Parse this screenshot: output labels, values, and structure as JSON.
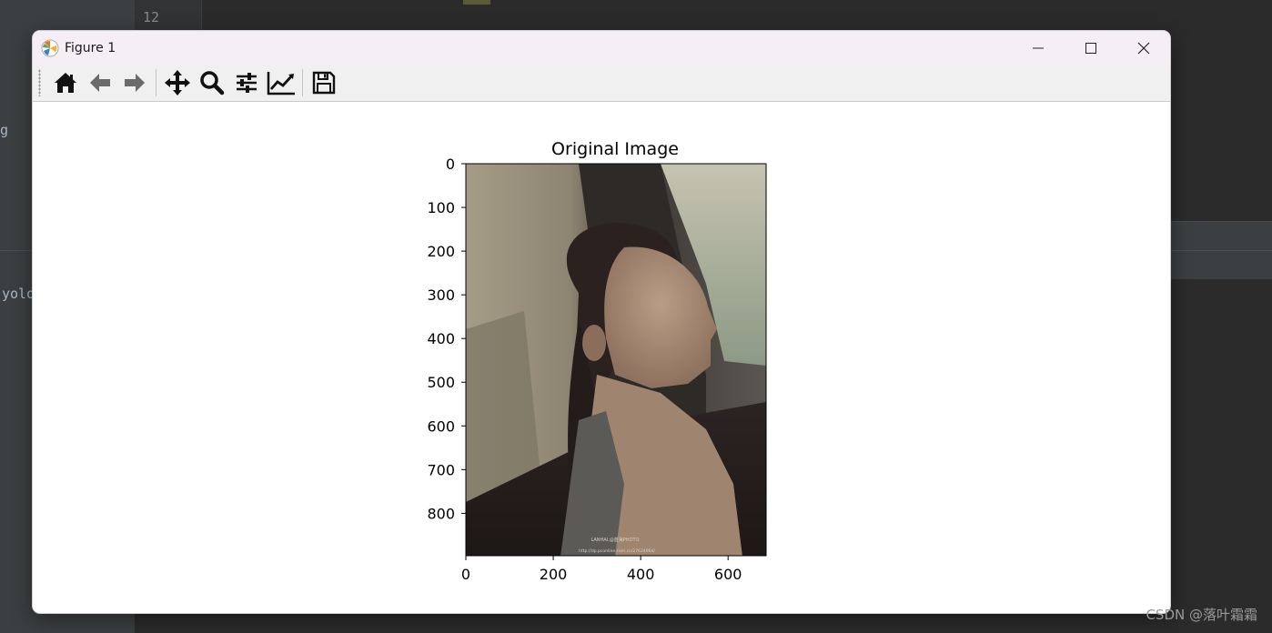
{
  "ide": {
    "line_number": "12",
    "fragment_1": "g",
    "fragment_2": "yolo"
  },
  "window": {
    "title": "Figure 1",
    "controls": {
      "minimize_icon": "minimize-icon",
      "maximize_icon": "maximize-icon",
      "close_icon": "close-icon"
    }
  },
  "toolbar": {
    "buttons": [
      {
        "name": "home",
        "icon": "home-icon"
      },
      {
        "name": "back",
        "icon": "arrow-left-icon"
      },
      {
        "name": "forward",
        "icon": "arrow-right-icon"
      },
      {
        "name": "pan",
        "icon": "move-icon"
      },
      {
        "name": "zoom",
        "icon": "zoom-icon"
      },
      {
        "name": "subplots",
        "icon": "sliders-icon"
      },
      {
        "name": "edit-axes",
        "icon": "line-chart-icon"
      },
      {
        "name": "save",
        "icon": "save-icon"
      }
    ]
  },
  "figure": {
    "title": "Original Image",
    "image_text_1": "LANHAI.@蓝海PHOTO",
    "image_text_2": "http://dp.pconline.com.cn/27624964/",
    "x_ticks": [
      "0",
      "200",
      "400",
      "600"
    ],
    "y_ticks": [
      "0",
      "100",
      "200",
      "300",
      "400",
      "500",
      "600",
      "700",
      "800"
    ],
    "image_extent": {
      "width": 687,
      "height": 897
    }
  },
  "watermark": "CSDN @落叶霜霜"
}
